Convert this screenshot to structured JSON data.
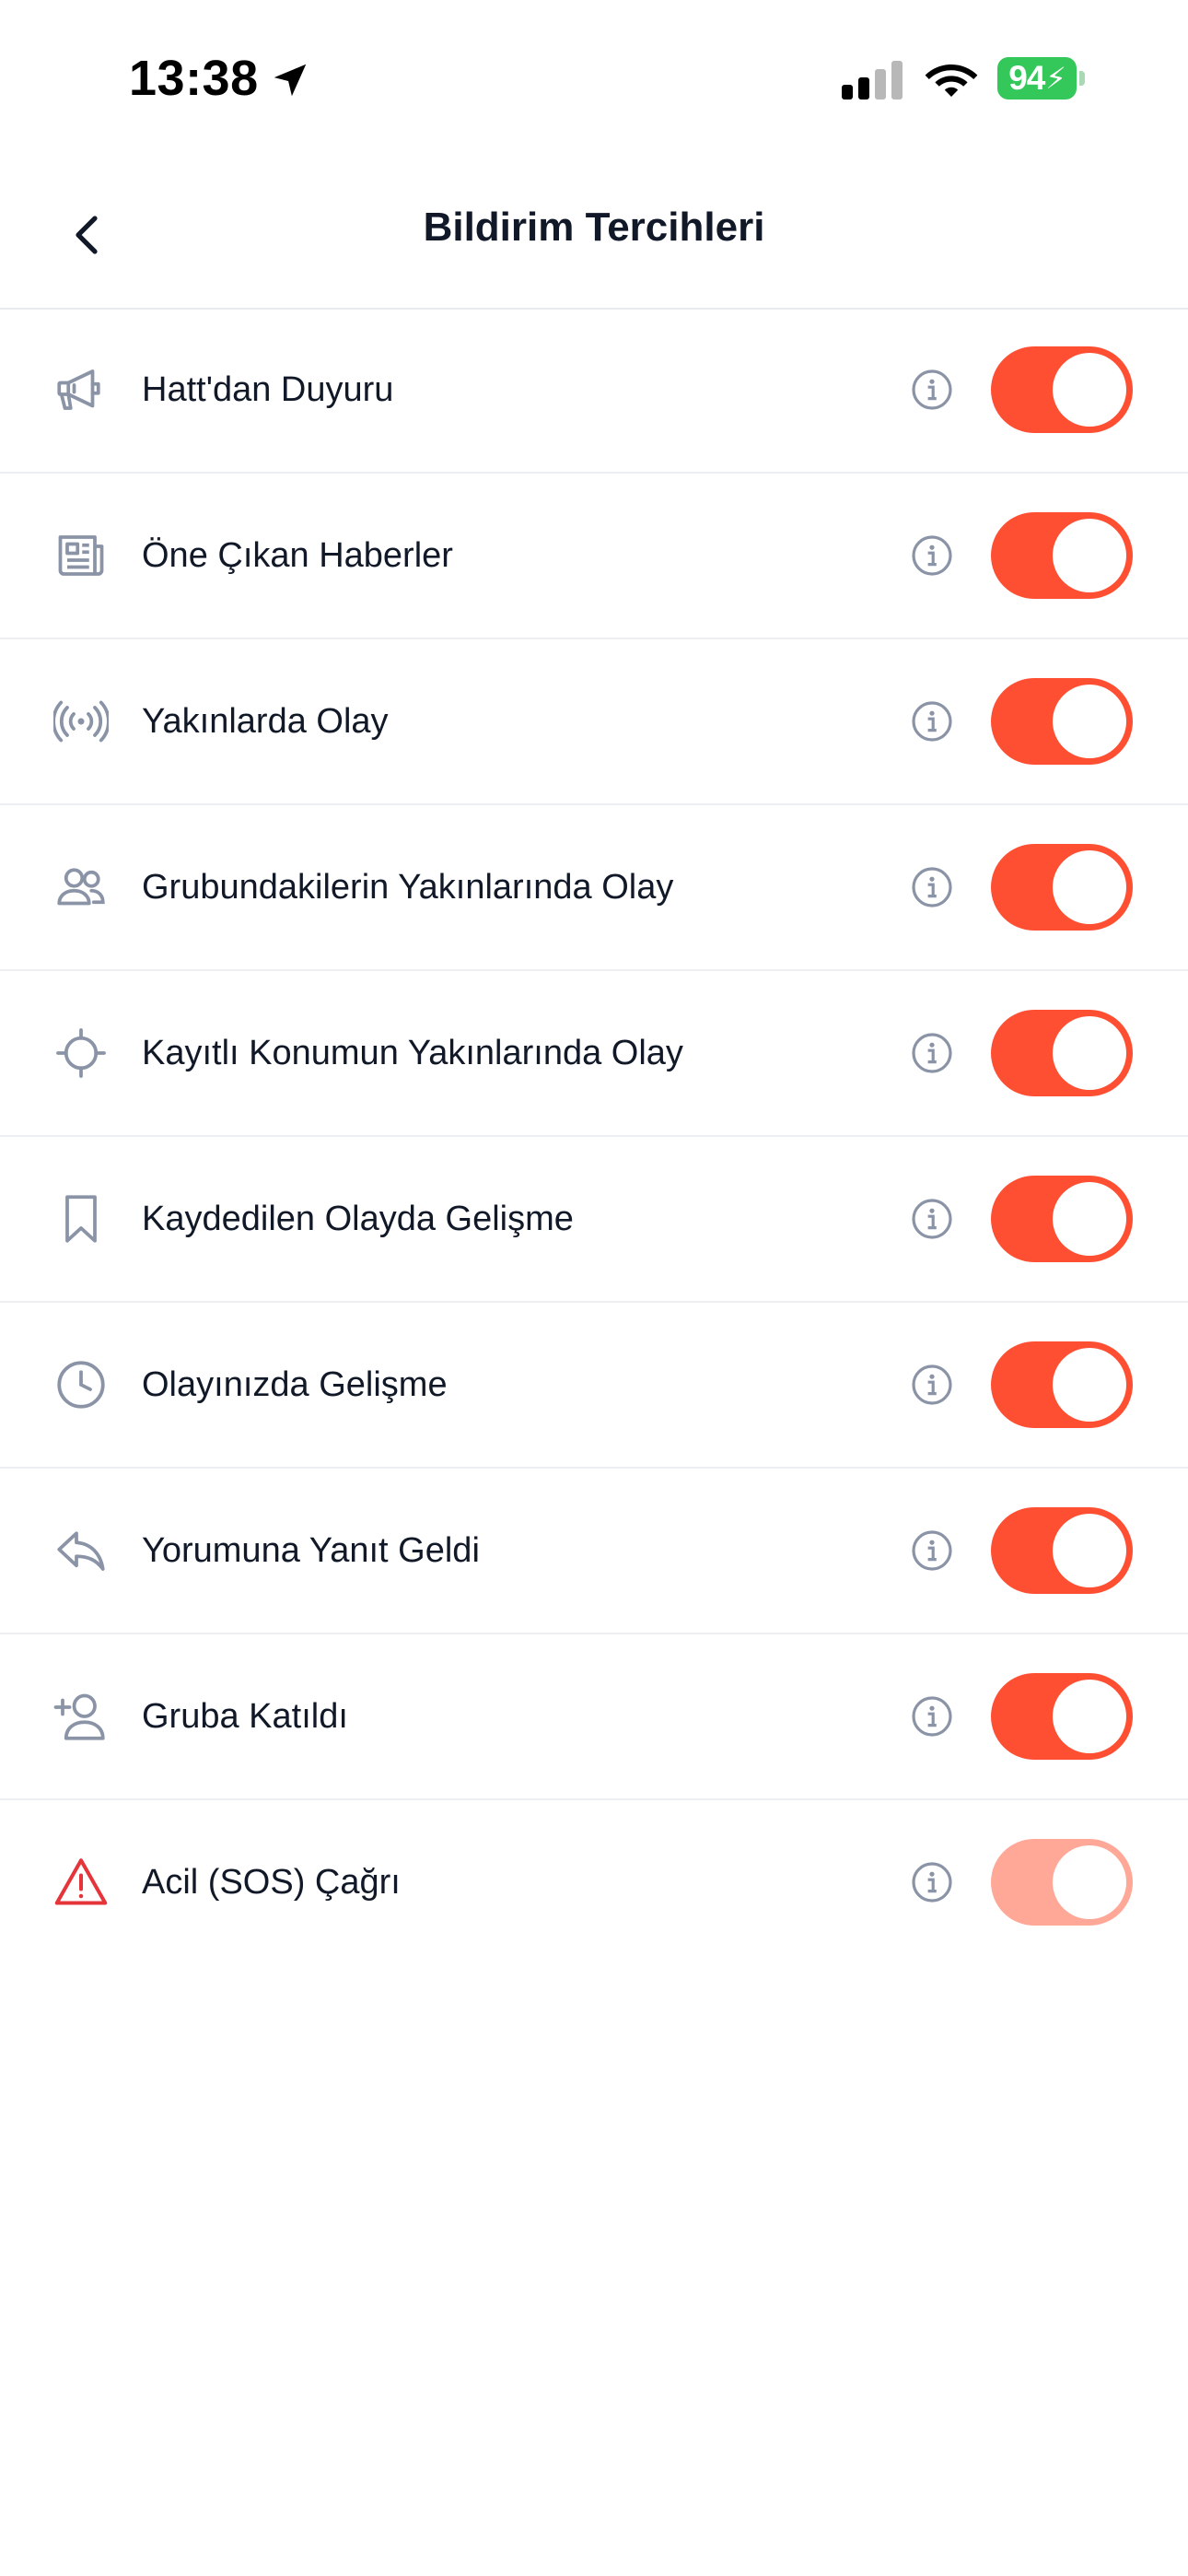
{
  "status_bar": {
    "time": "13:38",
    "battery_level": "94",
    "battery_color": "#34c759"
  },
  "header": {
    "title": "Bildirim Tercihleri",
    "back_icon": "chevron-left-icon"
  },
  "accent_color": "#ff4f33",
  "items": [
    {
      "label": "Hatt'dan Duyuru",
      "icon": "megaphone-icon",
      "enabled": true
    },
    {
      "label": "Öne Çıkan Haberler",
      "icon": "newspaper-icon",
      "enabled": true
    },
    {
      "label": "Yakınlarda Olay",
      "icon": "broadcast-icon",
      "enabled": true
    },
    {
      "label": "Grubundakilerin Yakınlarında Olay",
      "icon": "users-icon",
      "enabled": true
    },
    {
      "label": "Kayıtlı Konumun Yakınlarında Olay",
      "icon": "crosshair-icon",
      "enabled": true
    },
    {
      "label": "Kaydedilen Olayda Gelişme",
      "icon": "bookmark-icon",
      "enabled": true
    },
    {
      "label": "Olayınızda Gelişme",
      "icon": "clock-icon",
      "enabled": true
    },
    {
      "label": "Yorumuna Yanıt Geldi",
      "icon": "reply-icon",
      "enabled": true
    },
    {
      "label": "Gruba Katıldı",
      "icon": "user-plus-icon",
      "enabled": true
    },
    {
      "label": "Acil (SOS) Çağrı",
      "icon": "warning-icon",
      "enabled": true,
      "locked": true
    }
  ]
}
